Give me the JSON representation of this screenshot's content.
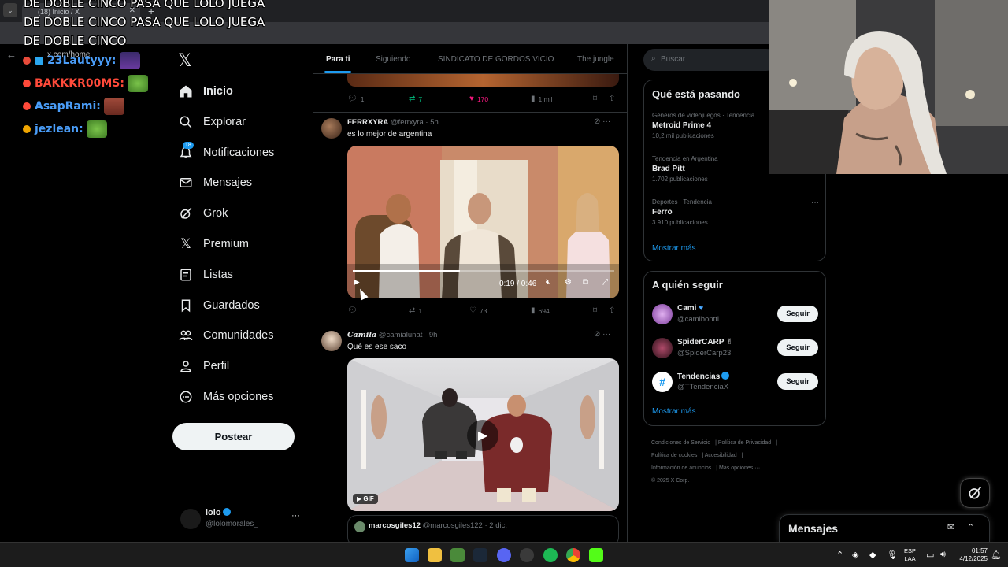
{
  "browser": {
    "tab_title": "(18) Inicio / X",
    "url": "x.com/home"
  },
  "stream": {
    "alert_text": "DE DOBLE CINCO PASA QUE LOLO JUEGA DE DOBLE CINCO PASA QUE LOLO JUEGA DE DOBLE CINCO",
    "chat": [
      {
        "user": "23Lautyyy:",
        "color": "#4a9df8",
        "badge": "#e84b3a"
      },
      {
        "user": "BAKKKR00MS:",
        "color": "#ff4a3a",
        "badge": "#ff4a3a"
      },
      {
        "user": "AsapRami:",
        "color": "#4a9df8",
        "badge": "#ff4a3a"
      },
      {
        "user": "jezlean:",
        "color": "#4a9df8",
        "badge": "#f0a500"
      }
    ]
  },
  "nav": {
    "items": [
      {
        "label": "Inicio",
        "icon": "home-icon"
      },
      {
        "label": "Explorar",
        "icon": "search-icon"
      },
      {
        "label": "Notificaciones",
        "icon": "bell-icon"
      },
      {
        "label": "Mensajes",
        "icon": "envelope-icon"
      },
      {
        "label": "Grok",
        "icon": "grok-icon"
      },
      {
        "label": "Premium",
        "icon": "x-icon"
      },
      {
        "label": "Listas",
        "icon": "list-icon"
      },
      {
        "label": "Guardados",
        "icon": "bookmark-icon"
      },
      {
        "label": "Comunidades",
        "icon": "people-icon"
      },
      {
        "label": "Perfil",
        "icon": "person-icon"
      },
      {
        "label": "Más opciones",
        "icon": "more-circle-icon"
      }
    ],
    "notif_count": "18",
    "post_label": "Postear",
    "profile": {
      "name": "lolo",
      "handle": "@lolomorales_"
    }
  },
  "feed": {
    "tabs": [
      "Para ti",
      "Siguiendo",
      "SINDICATO DE GORDOS VICIO",
      "The jungle"
    ],
    "prev_actions": {
      "replies": "1",
      "reposts": "7",
      "likes": "170",
      "views": "1 mil"
    },
    "tweet1": {
      "name": "FERRXYRA",
      "handle": "@ferrxyra · 5h",
      "text": "es lo mejor de argentina",
      "video_time": "0:19 / 0:46",
      "progress": 0.41,
      "actions": {
        "replies": "",
        "reposts": "1",
        "likes": "73",
        "views": "694"
      }
    },
    "tweet2": {
      "name": "Camila",
      "handle": "@camialunat · 9h",
      "text": "Qué es ese saco",
      "gif_label": "GIF",
      "quote": {
        "name": "marcosgiles12",
        "handle": "@marcosgiles122 · 2 dic."
      }
    }
  },
  "sidebar": {
    "search_placeholder": "Buscar",
    "trends_title": "Qué está pasando",
    "trends": [
      {
        "meta": "Géneros de videojuegos · Tendencia",
        "name": "Metroid Prime 4",
        "count": "10,2 mil publicaciones"
      },
      {
        "meta": "Tendencia en Argentina",
        "name": "Brad Pitt",
        "count": "1.702 publicaciones"
      },
      {
        "meta": "Deportes · Tendencia",
        "name": "Ferro",
        "count": "3.910 publicaciones"
      }
    ],
    "show_more": "Mostrar más",
    "follow_title": "A quién seguir",
    "follow": [
      {
        "name": "Cami",
        "handle": "@camibonttl",
        "avatar": "#c58ad6"
      },
      {
        "name": "SpiderCARP",
        "handle": "@SpiderCarp23",
        "avatar": "#8a3050"
      },
      {
        "name": "Tendencias",
        "handle": "@TTendenciaX",
        "avatar": "#ffffff"
      }
    ],
    "follow_btn": "Seguir",
    "footer": [
      "Condiciones de Servicio",
      "Política de Privacidad",
      "Política de cookies",
      "Accesibilidad",
      "Información de anuncios",
      "Más opciones ···",
      "© 2025 X Corp."
    ]
  },
  "messages": {
    "title": "Mensajes"
  },
  "taskbar": {
    "lang_top": "ESP",
    "lang_bottom": "LAA",
    "time": "01:57",
    "date": "4/12/2025"
  }
}
